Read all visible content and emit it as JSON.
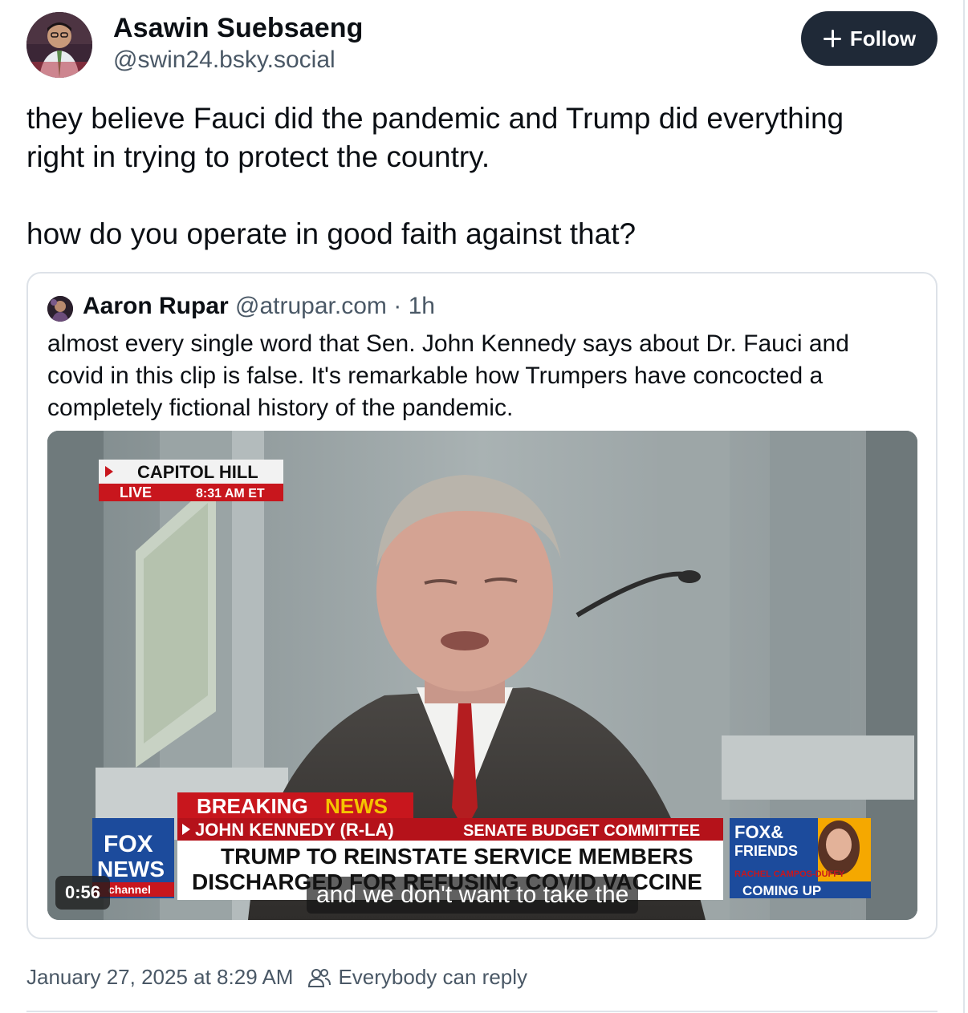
{
  "author": {
    "name": "Asawin Suebsaeng",
    "handle": "@swin24.bsky.social"
  },
  "follow": {
    "label": "Follow",
    "icon": "plus-icon"
  },
  "post": {
    "lines": [
      "they believe Fauci did the pandemic and Trump did everything",
      "right in trying to protect the country.",
      "",
      "how do you operate in good faith against that?"
    ]
  },
  "quote": {
    "author_name": "Aaron Rupar",
    "author_handle": "@atrupar.com",
    "separator": " · ",
    "time": "1h",
    "lines": [
      "almost every single word that Sen. John Kennedy says about Dr. Fauci and",
      "covid in this clip is false. It's remarkable how Trumpers have concocted a",
      "completely fictional history of the pandemic."
    ],
    "video": {
      "duration": "0:56",
      "caption": "and we don't want to take the",
      "overlay": {
        "location": "CAPITOL HILL",
        "live": "LIVE",
        "live_time": "8:31 AM ET",
        "breaking": "BREAKING",
        "news": "NEWS",
        "subject": "JOHN KENNEDY (R-LA)",
        "committee": "SENATE BUDGET COMMITTEE",
        "headline_1": "TRUMP TO REINSTATE SERVICE MEMBERS",
        "headline_2": "DISCHARGED FOR REFUSING COVID VACCINE",
        "network_1": "FOX",
        "network_2": "NEWS",
        "network_3": "channel",
        "show_1": "FOX&",
        "show_2": "FRIENDS",
        "host": "RACHEL CAMPOS-DUFFY",
        "coming_up": "COMING UP"
      }
    }
  },
  "footer": {
    "timestamp": "January 27, 2025 at 8:29 AM",
    "reply_setting": "Everybody can reply",
    "reply_icon": "people-icon"
  },
  "colors": {
    "follow_bg": "#1f2937",
    "muted_text": "#4a5866",
    "border": "#dde2e8",
    "breaking_red": "#c8161d",
    "news_yellow": "#f5c400",
    "fox_blue": "#1c4b9c"
  }
}
